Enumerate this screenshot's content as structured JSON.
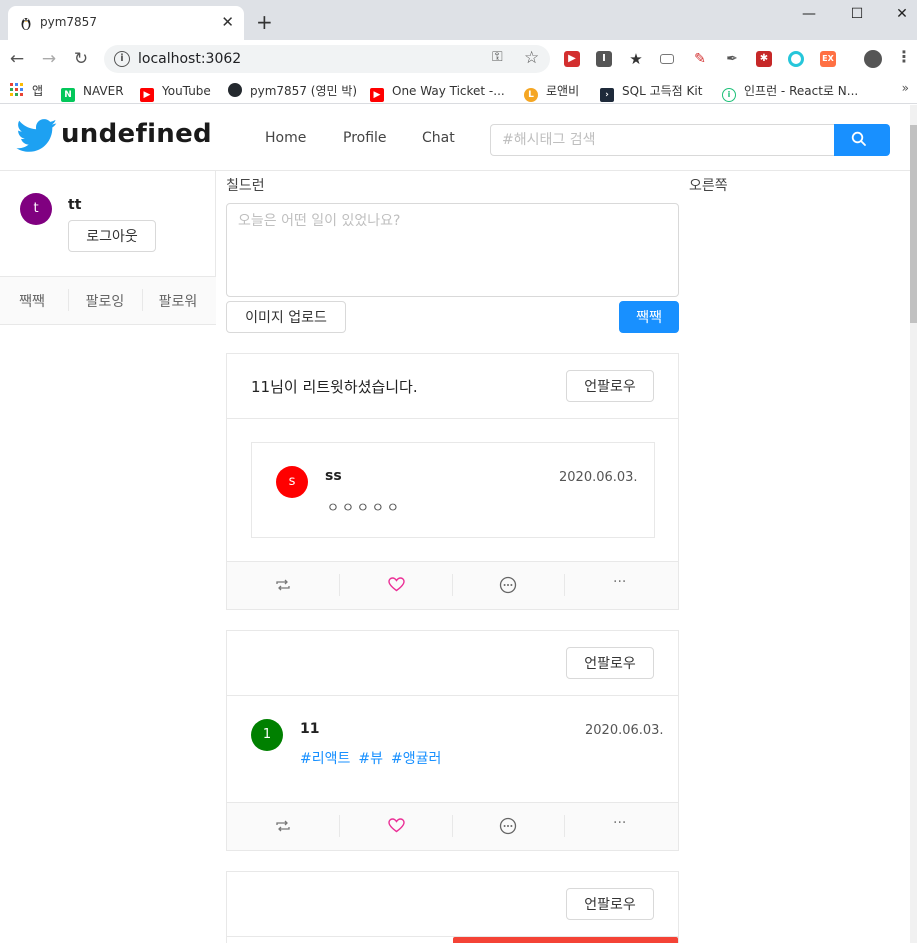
{
  "browser": {
    "tab_title": "pym7857",
    "url": "localhost:3062",
    "bookmarks": [
      {
        "label": "앱",
        "icon": "apps-grid-icon",
        "color": "#e94235"
      },
      {
        "label": "NAVER",
        "icon": "naver-icon",
        "color": "#03c75a"
      },
      {
        "label": "YouTube",
        "icon": "youtube-icon",
        "color": "#ff0000"
      },
      {
        "label": "pym7857 (영민 박)",
        "icon": "github-icon",
        "color": "#24292e"
      },
      {
        "label": "One Way Ticket -...",
        "icon": "youtube-icon",
        "color": "#ff0000"
      },
      {
        "label": "로앤비",
        "icon": "lawnb-icon",
        "color": "#f5a623"
      },
      {
        "label": "SQL 고득점 Kit",
        "icon": "programmers-icon",
        "color": "#1e2a3a"
      },
      {
        "label": "인프런 - React로 N...",
        "icon": "inflearn-icon",
        "color": "#1dc078"
      }
    ]
  },
  "header": {
    "logo_text": "undefined",
    "menu": [
      "Home",
      "Profile",
      "Chat"
    ],
    "search_placeholder": "#해시태그 검색"
  },
  "profile": {
    "avatar_initial": "t",
    "avatar_color": "#800080",
    "name": "tt",
    "logout_label": "로그아웃",
    "actions": [
      "짹짹",
      "팔로잉",
      "팔로워"
    ]
  },
  "left_col_label": "칠드런",
  "right_col_label": "오른쪽",
  "post_form": {
    "placeholder": "오늘은 어떤 일이 있었나요?",
    "upload_label": "이미지 업로드",
    "submit_label": "짹짹"
  },
  "posts": [
    {
      "header_title": "11님이 리트윗하셨습니다.",
      "unfollow_label": "언팔로우",
      "author": "ss",
      "avatar_initial": "s",
      "avatar_color": "#ff0000",
      "date": "2020.06.03.",
      "content": "ㅇㅇㅇㅇㅇ"
    },
    {
      "header_title": "",
      "unfollow_label": "언팔로우",
      "author": "11",
      "avatar_initial": "1",
      "avatar_color": "#008000",
      "date": "2020.06.03.",
      "hashtags": [
        "#리액트",
        "#뷰",
        "#앵귤러"
      ]
    },
    {
      "header_title": "",
      "unfollow_label": "언팔로우"
    }
  ],
  "colors": {
    "primary": "#1890ff",
    "like": "#eb2f96",
    "twitter_logo": "#1da1f2"
  }
}
